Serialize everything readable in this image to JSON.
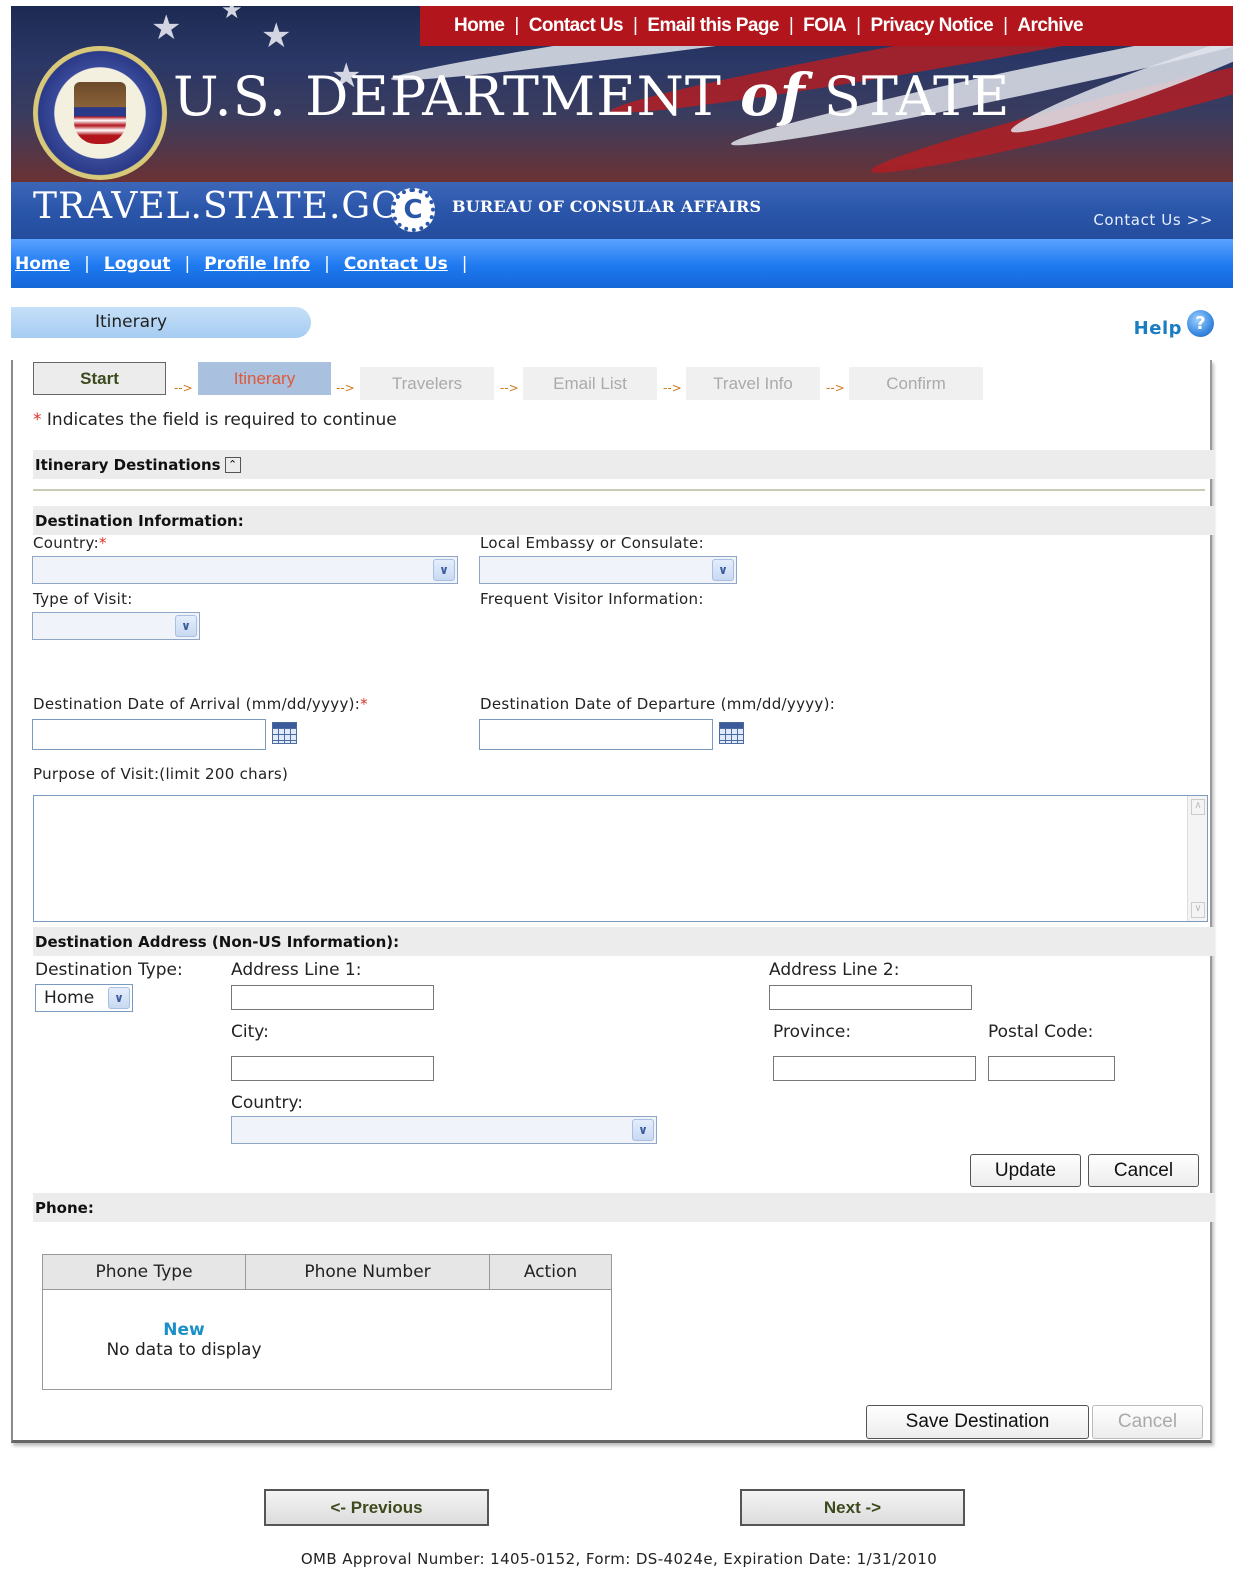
{
  "header": {
    "top_links": [
      "Home",
      "Contact Us",
      "Email this Page",
      "FOIA",
      "Privacy Notice",
      "Archive"
    ],
    "dept_title_pre": "U.S. DEPARTMENT ",
    "dept_title_of": "of",
    "dept_title_post": " STATE",
    "travel_logo": "TRAVEL.STATE.GOV",
    "c_badge": "C",
    "bureau": "BUREAU OF CONSULAR AFFAIRS",
    "contact_us": "Contact Us >>"
  },
  "subnav": [
    "Home",
    "Logout",
    "Profile Info",
    "Contact Us"
  ],
  "page": {
    "tab_label": "Itinerary",
    "help_label": "Help",
    "help_icon": "?"
  },
  "steps": [
    {
      "label": "Start",
      "state": "done"
    },
    {
      "label": "Itinerary",
      "state": "current"
    },
    {
      "label": "Travelers",
      "state": "future"
    },
    {
      "label": "Email List",
      "state": "future"
    },
    {
      "label": "Travel Info",
      "state": "future"
    },
    {
      "label": "Confirm",
      "state": "future"
    }
  ],
  "step_arrow": "-->",
  "required_note": {
    "star": "*",
    "text": " Indicates the field is required to continue"
  },
  "sections": {
    "itinerary_destinations": "Itinerary Destinations",
    "collapse_icon": "⌃",
    "destination_information": "Destination Information:",
    "destination_address": "Destination Address (Non-US Information):",
    "phone": "Phone:"
  },
  "form": {
    "country_label": "Country:",
    "req_star": "*",
    "embassy_label": "Local Embassy or Consulate:",
    "type_of_visit_label": "Type of Visit:",
    "frequent_visitor_label": "Frequent Visitor Information:",
    "arrival_label": "Destination Date of Arrival (mm/dd/yyyy):",
    "departure_label": "Destination Date of Departure (mm/dd/yyyy):",
    "purpose_label": "Purpose of Visit:(limit 200 chars)",
    "purpose_value": "",
    "destination_type_label": "Destination Type:",
    "destination_type_value": "Home",
    "address1_label": "Address Line 1:",
    "address2_label": "Address Line 2:",
    "city_label": "City:",
    "province_label": "Province:",
    "postal_label": "Postal Code:",
    "address_country_label": "Country:"
  },
  "buttons": {
    "update": "Update",
    "cancel": "Cancel",
    "save_destination": "Save Destination",
    "cancel_disabled": "Cancel",
    "previous": "<- Previous",
    "next": "Next ->"
  },
  "phone_table": {
    "columns": [
      "Phone Type",
      "Phone Number",
      "Action"
    ],
    "new_link": "New",
    "empty_text": "No data to display"
  },
  "footer": "OMB Approval Number: 1405-0152, Form: DS-4024e, Expiration Date: 1/31/2010",
  "colors": {
    "nav_red": "#b2151c",
    "nav_blue": "#1e79f0",
    "required": "#e0302a",
    "link_blue": "#1b90c6"
  }
}
